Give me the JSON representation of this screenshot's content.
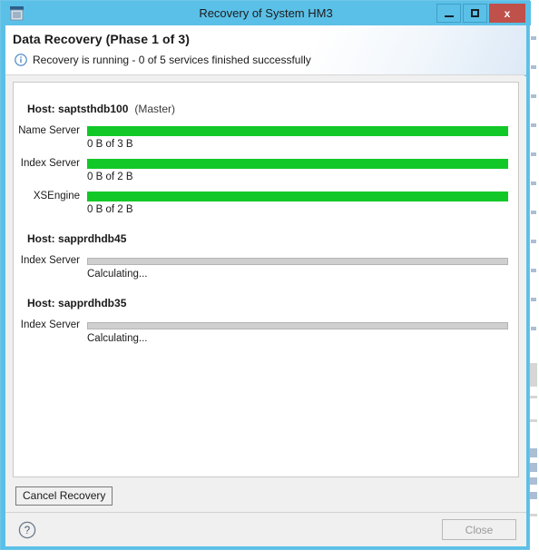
{
  "window": {
    "title": "Recovery of System HM3",
    "app_icon": "window-app-icon",
    "buttons": {
      "minimize": "minimize-icon",
      "maximize": "maximize-icon",
      "close": "x"
    }
  },
  "header": {
    "title": "Data Recovery (Phase 1 of 3)",
    "status_icon": "info-icon",
    "status_text": "Recovery is running - 0 of 5 services finished successfully"
  },
  "hosts": [
    {
      "host_prefix": "Host:",
      "name": "saptsthdb100",
      "role": "(Master)",
      "services": [
        {
          "label": "Name Server",
          "state": "green",
          "percent": 100,
          "detail": "0 B of 3 B"
        },
        {
          "label": "Index Server",
          "state": "green",
          "percent": 100,
          "detail": "0 B of 2 B"
        },
        {
          "label": "XSEngine",
          "state": "green",
          "percent": 100,
          "detail": "0 B of 2 B"
        }
      ]
    },
    {
      "host_prefix": "Host:",
      "name": "sapprdhdb45",
      "role": "",
      "services": [
        {
          "label": "Index Server",
          "state": "empty",
          "percent": 0,
          "detail": "Calculating..."
        }
      ]
    },
    {
      "host_prefix": "Host:",
      "name": "sapprdhdb35",
      "role": "",
      "services": [
        {
          "label": "Index Server",
          "state": "empty",
          "percent": 0,
          "detail": "Calculating..."
        }
      ]
    }
  ],
  "actions": {
    "cancel_recovery": "Cancel Recovery",
    "help": "help-icon",
    "close": "Close",
    "close_enabled": false
  },
  "colors": {
    "titlebar": "#5bc0e7",
    "close_button": "#c0504a",
    "progress_green": "#12c828",
    "progress_empty": "#cfcfcf",
    "panel_bg": "#f0f0f0"
  }
}
